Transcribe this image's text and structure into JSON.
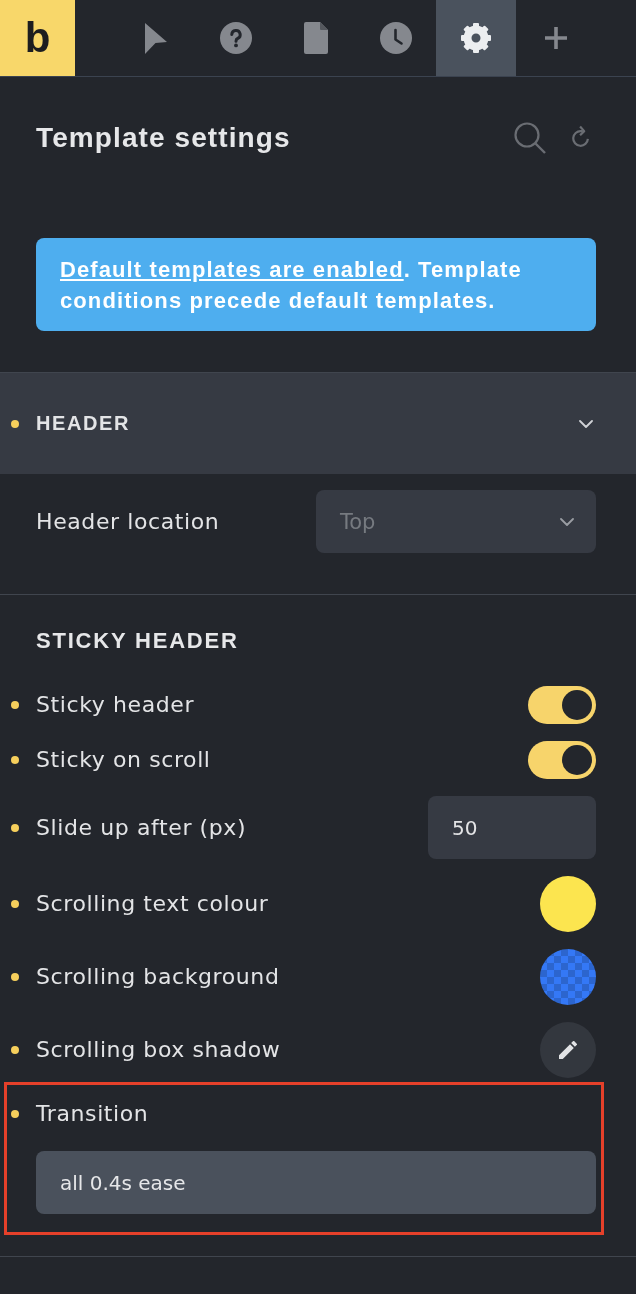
{
  "logo": {
    "text": "b"
  },
  "toolbar": {
    "tabs": [
      {
        "kind": "pointer",
        "selected": false
      },
      {
        "kind": "help",
        "selected": false
      },
      {
        "kind": "page",
        "selected": false
      },
      {
        "kind": "history",
        "selected": false
      },
      {
        "kind": "settings",
        "selected": true
      },
      {
        "kind": "add",
        "selected": false
      }
    ]
  },
  "panel": {
    "title": "Template settings",
    "actions": [
      {
        "kind": "search"
      },
      {
        "kind": "refresh"
      }
    ]
  },
  "notice": {
    "link": "Default templates are enabled",
    "text": ". Template conditions precede default templates."
  },
  "sections": [
    {
      "title": "HEADER",
      "modified": true,
      "expanded": true,
      "groups": [
        {
          "controls": [
            {
              "kind": "select",
              "label": "Header location",
              "placeholder": "Top",
              "modified": false
            }
          ]
        },
        {
          "title": "STICKY HEADER",
          "controls": [
            {
              "kind": "toggle",
              "label": "Sticky header",
              "on": true,
              "modified": true
            },
            {
              "kind": "toggle",
              "label": "Sticky on scroll",
              "on": true,
              "modified": true
            },
            {
              "kind": "number",
              "label": "Slide up after (px)",
              "value": "50",
              "modified": true
            },
            {
              "kind": "color",
              "label": "Scrolling text colour",
              "color": "#fce54f",
              "modified": true
            },
            {
              "kind": "background",
              "label": "Scrolling background",
              "color": "#3478f6",
              "modified": true
            },
            {
              "kind": "shadow",
              "label": "Scrolling box shadow",
              "modified": true
            },
            {
              "kind": "text",
              "label": "Transition",
              "value": "all 0.4s ease",
              "modified": true,
              "highlighted": true
            }
          ]
        }
      ]
    }
  ]
}
